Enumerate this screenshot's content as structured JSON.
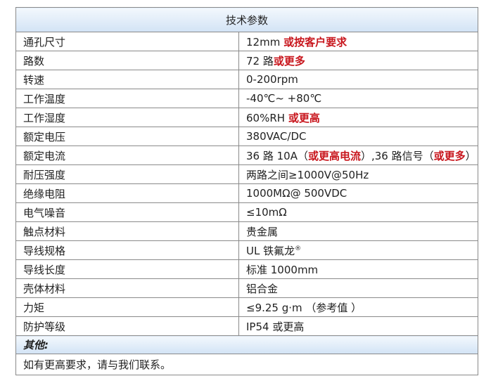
{
  "table": {
    "header": "技术参数",
    "rows": [
      {
        "label": "通孔尺寸",
        "value": "12mm ",
        "highlight": "或按客户要求",
        "tail": ""
      },
      {
        "label": "路数",
        "value": "72 路",
        "highlight": "或更多",
        "tail": ""
      },
      {
        "label": "转速",
        "value": "0-200rpm",
        "highlight": "",
        "tail": ""
      },
      {
        "label": "工作温度",
        "value": "-40℃~ +80℃",
        "highlight": "",
        "tail": ""
      },
      {
        "label": "工作湿度",
        "value": "60%RH ",
        "highlight": "或更高",
        "tail": ""
      },
      {
        "label": "额定电压",
        "value": "380VAC/DC",
        "highlight": "",
        "tail": ""
      },
      {
        "label": "额定电流",
        "value": "36 路 10A（",
        "highlight": "或更高电流",
        "tail": "）,36 路信号（",
        "highlight2": "或更多",
        "tail2": "）"
      },
      {
        "label": "耐压强度",
        "value": "两路之间≥1000V@50Hz",
        "highlight": "",
        "tail": ""
      },
      {
        "label": "绝缘电阻",
        "value": "1000MΩ@ 500VDC",
        "highlight": "",
        "tail": ""
      },
      {
        "label": "电气噪音",
        "value": "≤10mΩ",
        "highlight": "",
        "tail": ""
      },
      {
        "label": "触点材料",
        "value": "贵金属",
        "highlight": "",
        "tail": ""
      },
      {
        "label": "导线规格",
        "value": "UL 铁氟龙",
        "highlight": "",
        "tail": "",
        "sup": "®"
      },
      {
        "label": "导线长度",
        "value": "标准 1000mm",
        "highlight": "",
        "tail": ""
      },
      {
        "label": "壳体材料",
        "value": "铝合金",
        "highlight": "",
        "tail": ""
      },
      {
        "label": "力矩",
        "value": "≤9.25 g·m （参考值 ）",
        "highlight": "",
        "tail": ""
      },
      {
        "label": "防护等级",
        "value": "IP54 或更高",
        "highlight": "",
        "tail": ""
      }
    ],
    "other_label": "其他:",
    "other_text": "如有更高要求，请与我们联系。"
  },
  "colors": {
    "highlight": "#c8161d",
    "header_bg": "#d2e3f5",
    "border": "#8a8a8a"
  }
}
